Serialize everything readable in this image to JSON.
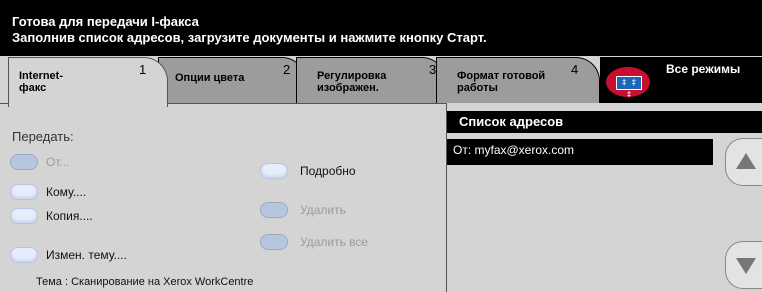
{
  "status": {
    "line1": "Готова для передачи I-факса",
    "line2": "Заполнив список адресов, загрузите документы и нажмите кнопку Старт."
  },
  "tabs": [
    {
      "label": "Internet-\nфакс",
      "number": "1"
    },
    {
      "label": "Опции цвета",
      "number": "2"
    },
    {
      "label": "Регулировка\nизображен.",
      "number": "3"
    },
    {
      "label": "Формат готовой\nработы",
      "number": "4"
    }
  ],
  "all_modes": {
    "label": "Все режимы",
    "icon_text": "‡ ‡ ‡",
    "icon": "all-modes-icon"
  },
  "send": {
    "label": "Передать:",
    "from": "От...",
    "to": "Кому....",
    "copy": "Копия....",
    "change_subject": "Измен. тему....",
    "details": "Подробно",
    "delete": "Удалить",
    "delete_all": "Удалить все",
    "subject": "Тема : Сканирование на Xerox WorkCentre"
  },
  "address_list": {
    "header": "Список адресов",
    "items": [
      "От: myfax@xerox.com"
    ]
  },
  "colors": {
    "accent_pill": "#e6eefc",
    "tab_inactive": "#9c9c9c",
    "panel": "#d4d4d4"
  }
}
